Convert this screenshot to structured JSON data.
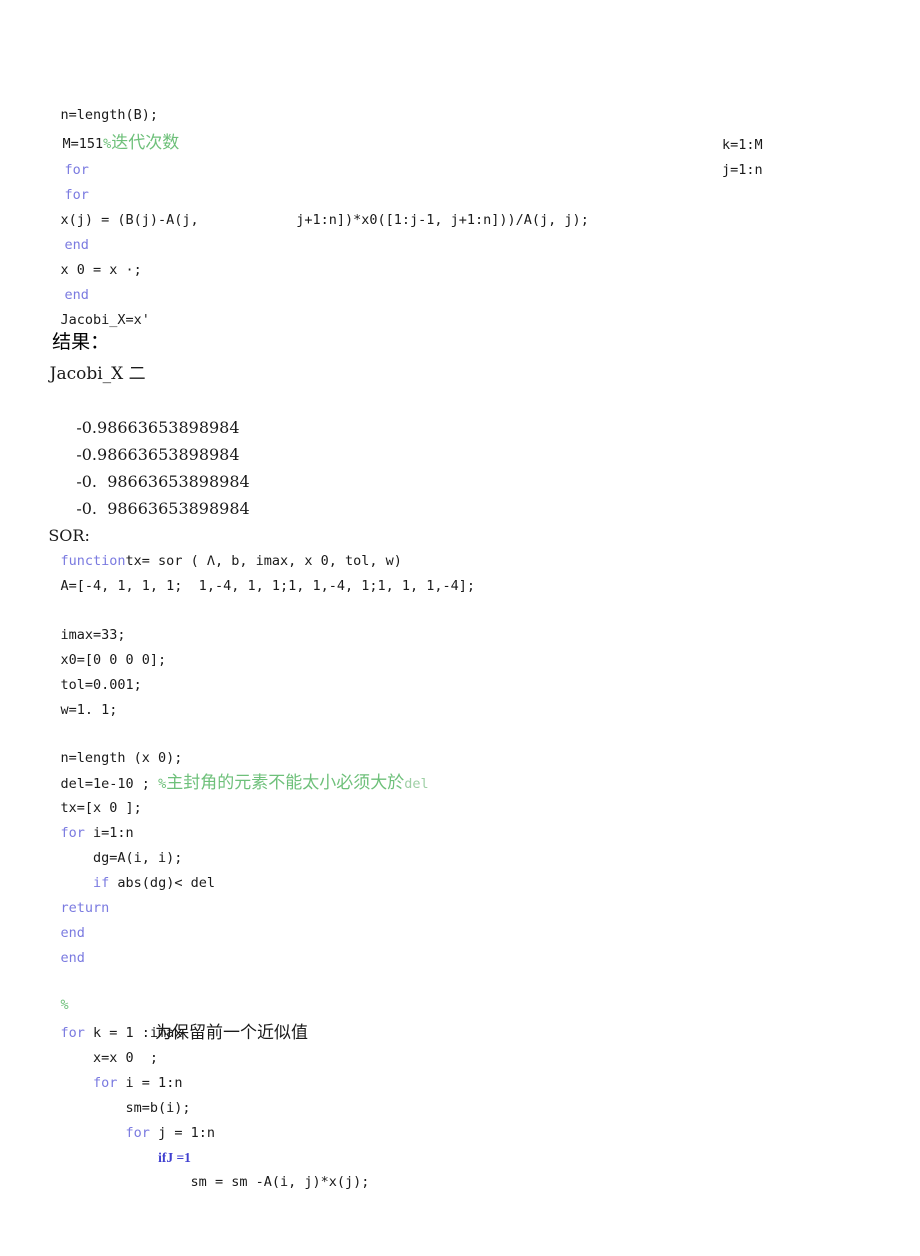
{
  "document": {
    "kind": "matlab-code-listing",
    "colors": {
      "background": "#ffffff",
      "text": "#1a1a1a",
      "keyword_blue": "#7a7ae0",
      "keyword_blue_strong": "#4040d0",
      "comment_green": "#6ec07a",
      "comment_green_light": "#9ecfa5"
    }
  },
  "jacobi": {
    "line_nlength": "n=length(B);",
    "line_M": {
      "code": "M=151",
      "comment_pct": "%",
      "comment_text": "迭代次数"
    },
    "line_for_k": {
      "keyword": "for",
      "trailing": "k=1:M"
    },
    "line_for_j": {
      "keyword": "for",
      "trailing": "j=1:n"
    },
    "line_xj": "x(j) = (B(j)-A(j,            j+1:n])*x0([1:j-1, j+1:n]))/A(j, j);",
    "line_end1": "end",
    "line_x0": "x 0 = x ·;",
    "line_end2": "end",
    "line_jacobiX": "Jacobi_X=x'"
  },
  "results": {
    "heading": "结果：",
    "subheading": "Jacobi_X 二",
    "values": [
      "-0.98663653898984",
      "-0.98663653898984",
      "-0.  98663653898984",
      "-0.  98663653898984"
    ]
  },
  "sor": {
    "label": "SOR:",
    "line_function": {
      "keyword": "function",
      "rest": "tx= sor ( Λ, b, imax, x 0, tol, w)"
    },
    "line_A": "A=[-4, 1, 1, 1;  1,-4, 1, 1;1, 1,-4, 1;1, 1, 1,-4];",
    "line_imax": "imax=33;",
    "line_x0": "x0=[0 0 0 0];",
    "line_tol": "tol=0.001;",
    "line_w": "w=1. 1;",
    "line_nlength": "n=length (x 0);",
    "line_del": {
      "code": "del=1e-10 ; ",
      "comment_pct": "%",
      "comment_text": "主封角的元素不能太小必须大於",
      "comment_tail": "del"
    },
    "line_tx": "tx=[x 0 ];",
    "line_for_i": {
      "keyword": "for",
      "rest": " i=1:n"
    },
    "line_dg": "    dg=A(i, i);",
    "line_if_abs": {
      "indent": "    ",
      "keyword": "if",
      "rest": " abs(dg)< del"
    },
    "line_return": "return",
    "line_end1": "end",
    "line_end2": "end",
    "line_pct": "%",
    "line_for_k": {
      "keyword": "for",
      "rest": " k = 1 :imax"
    },
    "line_x_eq": {
      "code": "    x=x 0  ;",
      "comment_text": "为保留前一个近似值"
    },
    "line_for_i2": {
      "indent": "    ",
      "keyword": "for",
      "rest": " i = 1:n"
    },
    "line_sm": "        sm=b(i);",
    "line_for_j": {
      "indent": "        ",
      "keyword": "for",
      "rest": " j = 1:n"
    },
    "line_if_J": {
      "indent": "            ",
      "keyword": "if",
      "rest": "J =1"
    },
    "line_sm_calc": "                sm = sm -A(i, j)*x(j);"
  }
}
